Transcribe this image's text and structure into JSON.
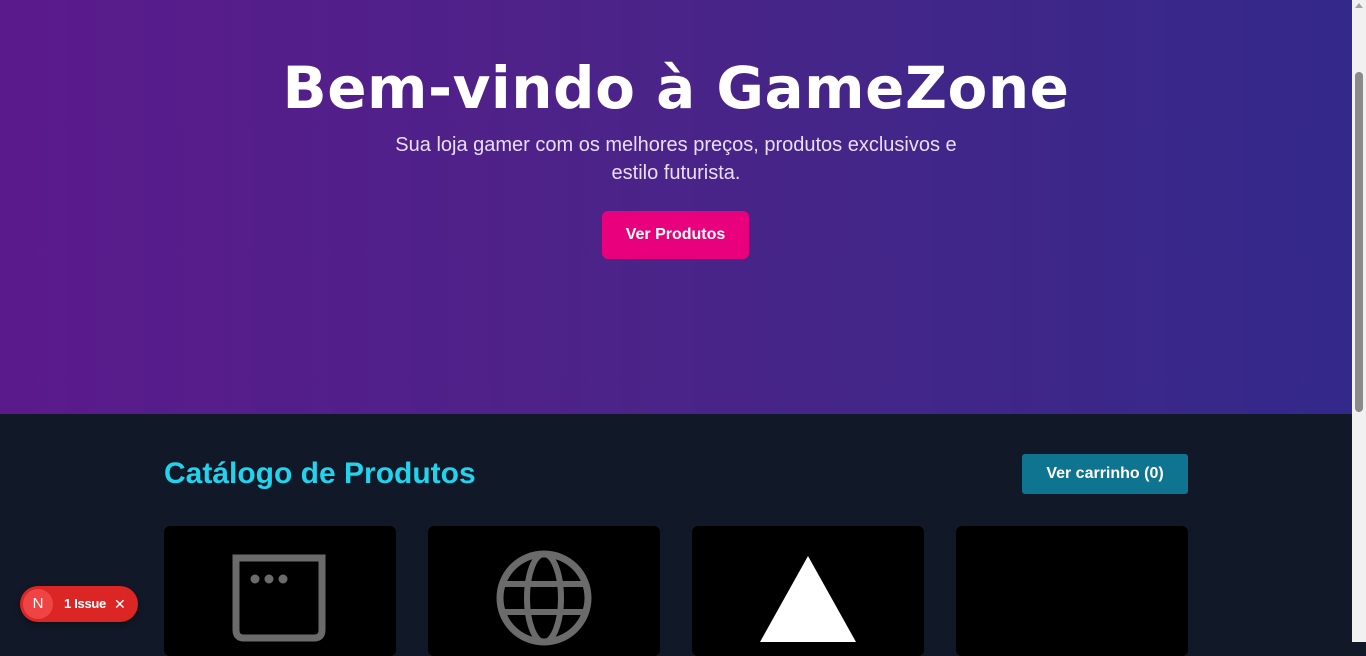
{
  "hero": {
    "title": "Bem-vindo à GameZone",
    "subtitle": "Sua loja gamer com os melhores preços, produtos exclusivos e estilo futurista.",
    "cta_label": "Ver Produtos"
  },
  "catalog": {
    "title": "Catálogo de Produtos",
    "cart_label": "Ver carrinho (0)",
    "products": [
      {
        "icon": "browser-window-icon"
      },
      {
        "icon": "globe-icon"
      },
      {
        "icon": "triangle-icon"
      },
      {
        "icon": ""
      }
    ]
  },
  "issue_badge": {
    "logo_letter": "N",
    "label": "1 Issue",
    "close_symbol": "✕"
  },
  "colors": {
    "hero_gradient_start": "#5b1a8c",
    "hero_gradient_end": "#33298a",
    "page_background": "#111827",
    "accent_pink": "#e8007d",
    "accent_cyan": "#22d3ee",
    "cart_button": "#0e7490",
    "issue_red": "#dc2626"
  }
}
